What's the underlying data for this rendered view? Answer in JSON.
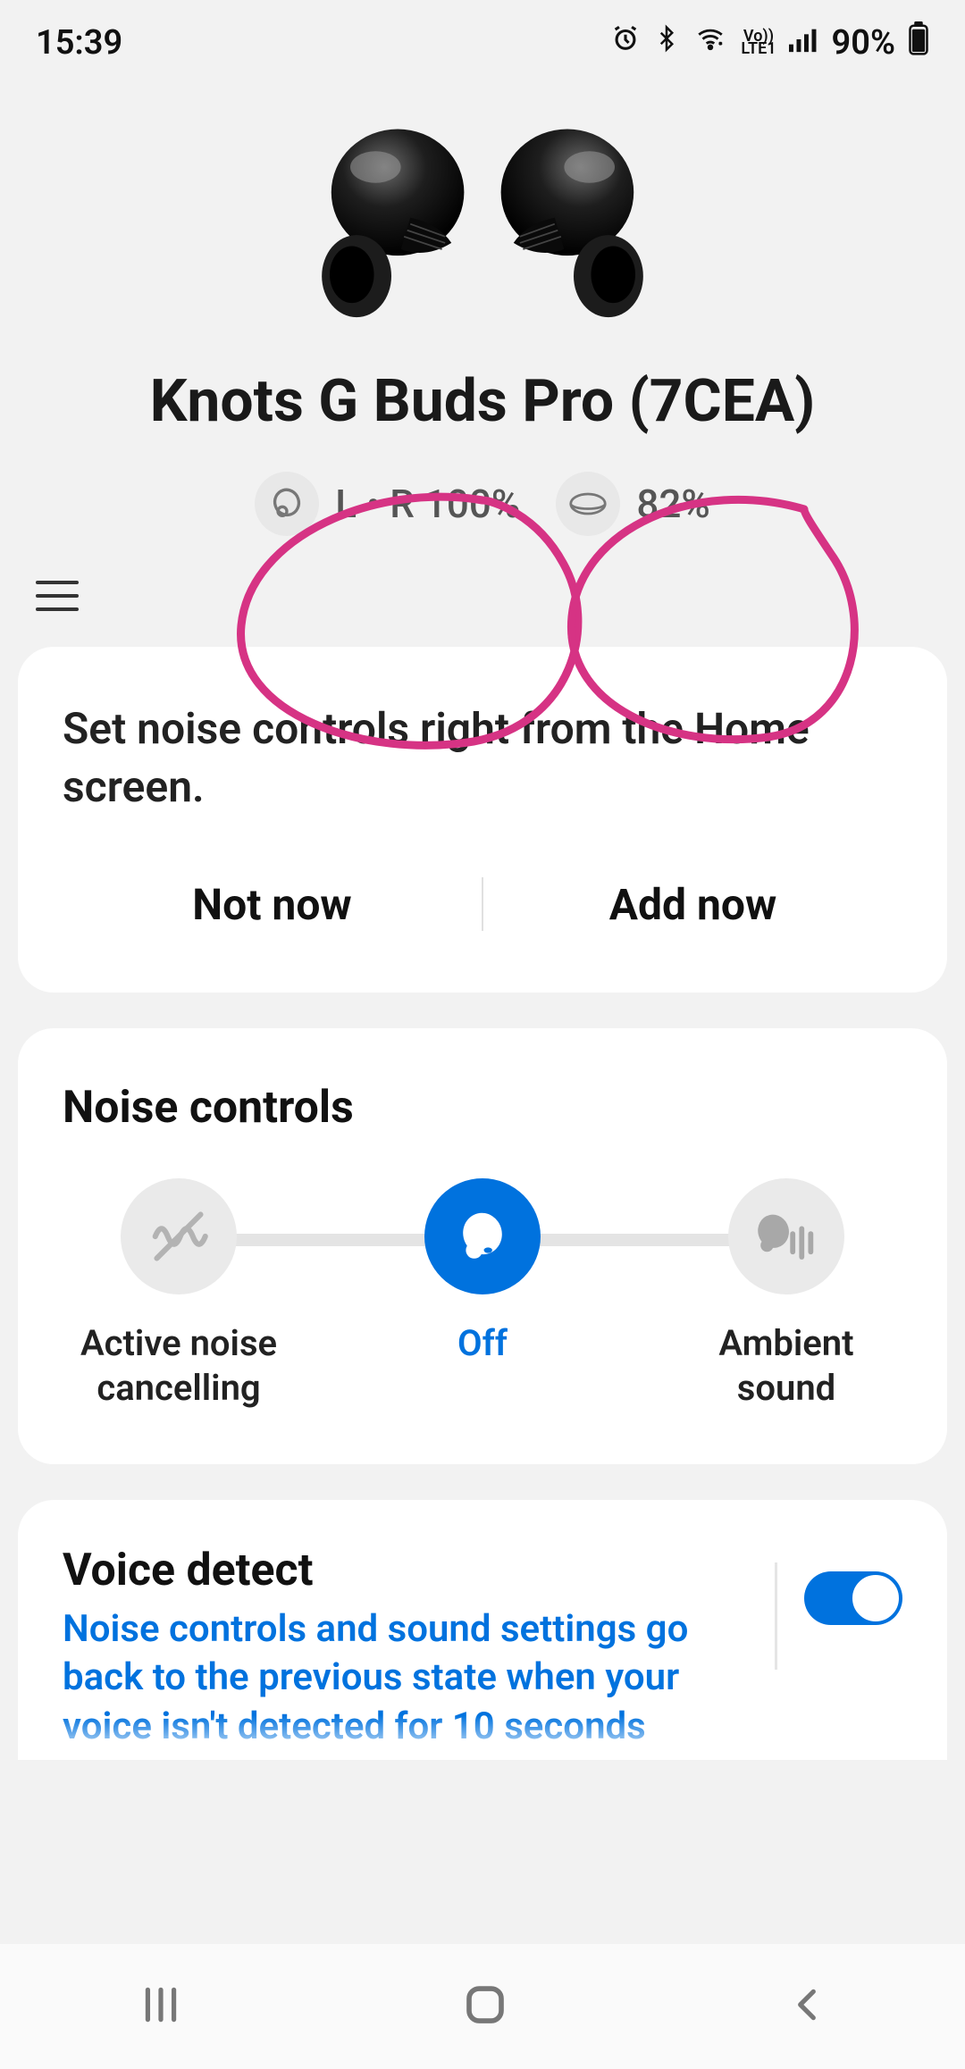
{
  "status": {
    "time": "15:39",
    "battery_pct": "90%"
  },
  "device": {
    "name": "Knots G Buds Pro (7CEA)",
    "earbuds_label": "L • R 100%",
    "case_label": "82%"
  },
  "promo": {
    "text": "Set noise controls right from the Home screen.",
    "not_now": "Not now",
    "add_now": "Add now"
  },
  "noise": {
    "title": "Noise controls",
    "options": {
      "anc": "Active noise cancelling",
      "off": "Off",
      "ambient": "Ambient sound"
    }
  },
  "voice": {
    "title": "Voice detect",
    "desc": "Noise controls and sound settings go back to the previous state when your voice isn't detected for 10 seconds"
  }
}
